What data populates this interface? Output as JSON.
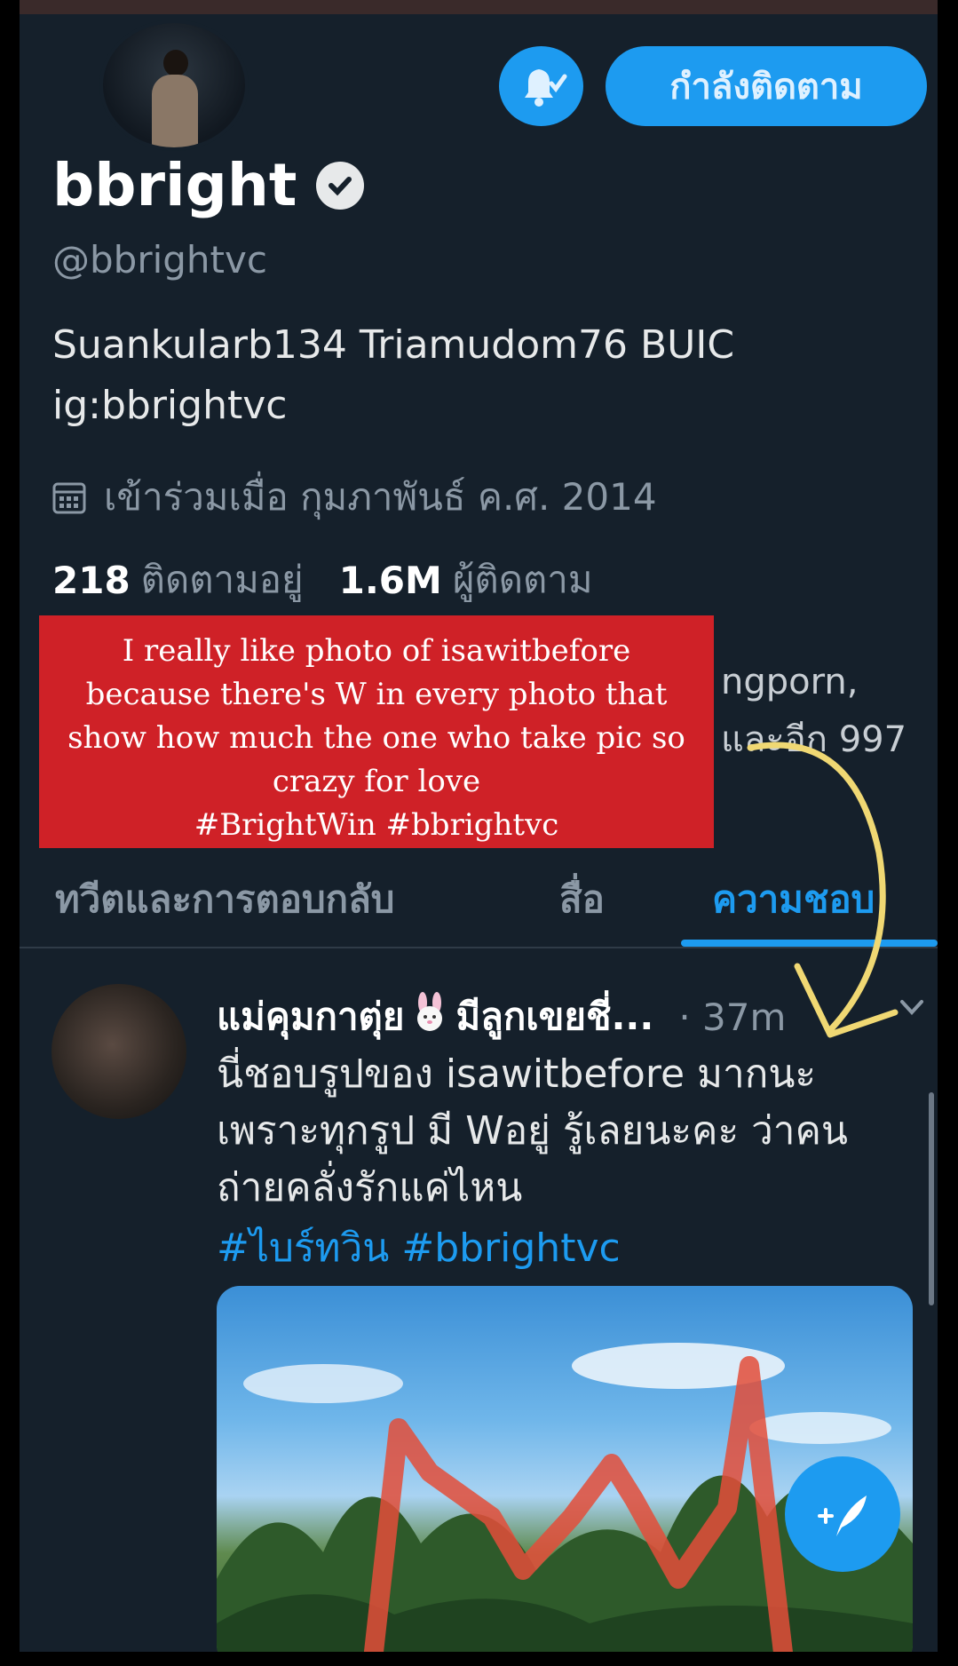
{
  "profile": {
    "follow_button": "กำลังติดตาม",
    "name": "bbright",
    "handle": "@bbrightvc",
    "bio_line1": "Suankularb134 Triamudom76 BUIC",
    "bio_line2": "ig:bbrightvc",
    "joined": "เข้าร่วมเมื่อ กุมภาพันธ์ ค.ศ. 2014",
    "following_count": "218",
    "following_label": "ติดตามอยู่",
    "followers_count": "1.6M",
    "followers_label": "ผู้ติดตาม",
    "followed_by_partial_1": "ngporn,",
    "followed_by_partial_2": "และอีก 997"
  },
  "caption_overlay": {
    "lines": [
      "I really like photo of isawitbefore",
      "because there's W in every photo that",
      "show how much  the one who take pic so",
      "crazy for love",
      "#BrightWin #bbrightvc"
    ],
    "color": "#cf2127"
  },
  "tabs": [
    {
      "label": "ทวีตและการตอบกลับ",
      "active": false
    },
    {
      "label": "สื่อ",
      "active": false
    },
    {
      "label": "ความชอบ",
      "active": true
    }
  ],
  "tweet": {
    "author": "แม่คุมกาตุ่ย",
    "author_suffix": "มีลูกเขยชี่...",
    "time": "· 37m",
    "body_line1": "นี่ชอบรูปของ isawitbefore มากนะ",
    "body_line2": "เพราะทุกรูป มี Wอยู่ รู้เลยนะคะ ว่าคน",
    "body_line3": "ถ่ายคลั่งรักแค่ไหน",
    "hashtags": "#ไบร์ทวิน #bbrightvc"
  },
  "icons": {
    "notification": "bell-check-icon",
    "verified": "verified-badge-icon",
    "calendar": "calendar-icon",
    "compose": "compose-tweet-icon",
    "more": "chevron-down-icon",
    "annotation": "yellow-arrow"
  },
  "colors": {
    "background": "#15202b",
    "accent": "#1d9bf0",
    "annotation_arrow": "#f0d873",
    "photo_w_mark": "#e34d3a"
  }
}
